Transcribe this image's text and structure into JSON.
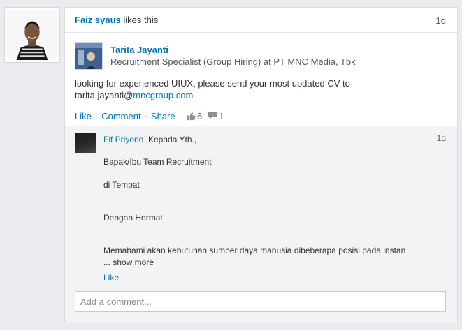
{
  "activity": {
    "actor_name": "Faiz syaus",
    "action_text": " likes this",
    "time": "1d"
  },
  "post": {
    "author_name": "Tarita Jayanti",
    "author_headline": "Recruitment Specialist (Group Hiring) at PT MNC Media, Tbk",
    "text_line1": "looking for experienced UIUX, please send your most updated CV to",
    "email_user": "tarita.jayanti@",
    "email_domain": "mncgroup.com"
  },
  "actions": {
    "like_label": "Like",
    "comment_label": "Comment",
    "share_label": "Share",
    "separator": "·",
    "like_count": "6",
    "comment_count": "1",
    "like_icon": "thumbs-up-icon",
    "comment_icon": "speech-bubble-icon"
  },
  "comment": {
    "author": "Fif Priyono",
    "time": "1d",
    "line1": "Kepada Yth.,",
    "line2": "Bapak/Ibu Team Recruitment",
    "line3": "di Tempat",
    "line4": "Dengan Hormat,",
    "line5": "Memahami akan kebutuhan sumber daya manusia dibeberapa posisi pada instan",
    "show_more": "... show more",
    "like_label": "Like"
  },
  "add_comment": {
    "placeholder": "Add a comment..."
  },
  "colors": {
    "link": "#0073b1",
    "background": "#e9ebee",
    "comments_bg": "#f2f3f5"
  }
}
